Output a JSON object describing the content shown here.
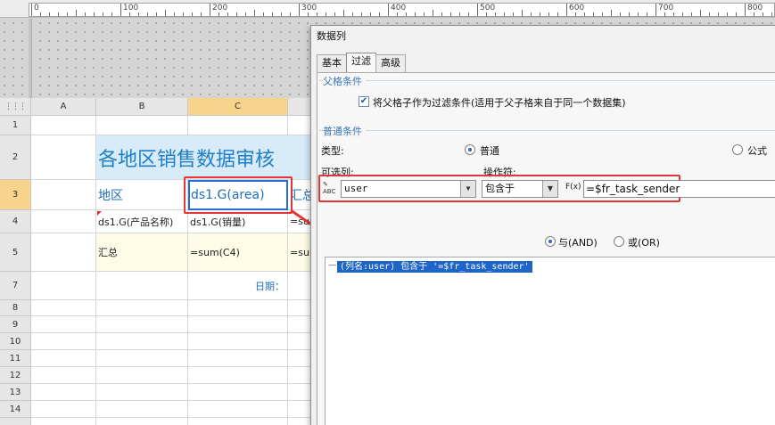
{
  "ruler": {
    "labels": [
      "0",
      "100",
      "200",
      "300",
      "400",
      "500",
      "600",
      "700",
      "800"
    ]
  },
  "sheet": {
    "corner_icon": "grid-icon",
    "columns": [
      "A",
      "B",
      "C"
    ],
    "rows": [
      "1",
      "2",
      "3",
      "4",
      "5",
      "7",
      "8",
      "9",
      "10",
      "11",
      "12",
      "13",
      "14"
    ],
    "title": "各地区销售数据审核",
    "cells": {
      "b3": "地区",
      "c3": "ds1.G(area)",
      "d3": "汇总",
      "b4": "ds1.G(产品名称)",
      "c4": "ds1.G(销量)",
      "d4": "=sum",
      "b5": "汇总",
      "c5": "=sum(C4)",
      "d5": "=sum",
      "c7": "日期："
    }
  },
  "dialog": {
    "title": "数据列",
    "tabs": [
      "基本",
      "过滤",
      "高级"
    ],
    "active_tab": "过滤",
    "parent_section": "父格条件",
    "parent_checkbox_label": "将父格子作为过滤条件(适用于父子格来自于同一个数据集)",
    "normal_section": "普通条件",
    "type_label": "类型:",
    "type_options": [
      "普通",
      "公式"
    ],
    "column_label": "可选列:",
    "operator_label": "操作符:",
    "column_value": "user",
    "operator_value": "包含于",
    "fx_label": "F(x)",
    "value_text": "=$fr_task_sender",
    "logic_options": [
      "与(AND)",
      "或(OR)"
    ],
    "condition_item": "(列名:user) 包含于 '=$fr_task_sender'"
  }
}
